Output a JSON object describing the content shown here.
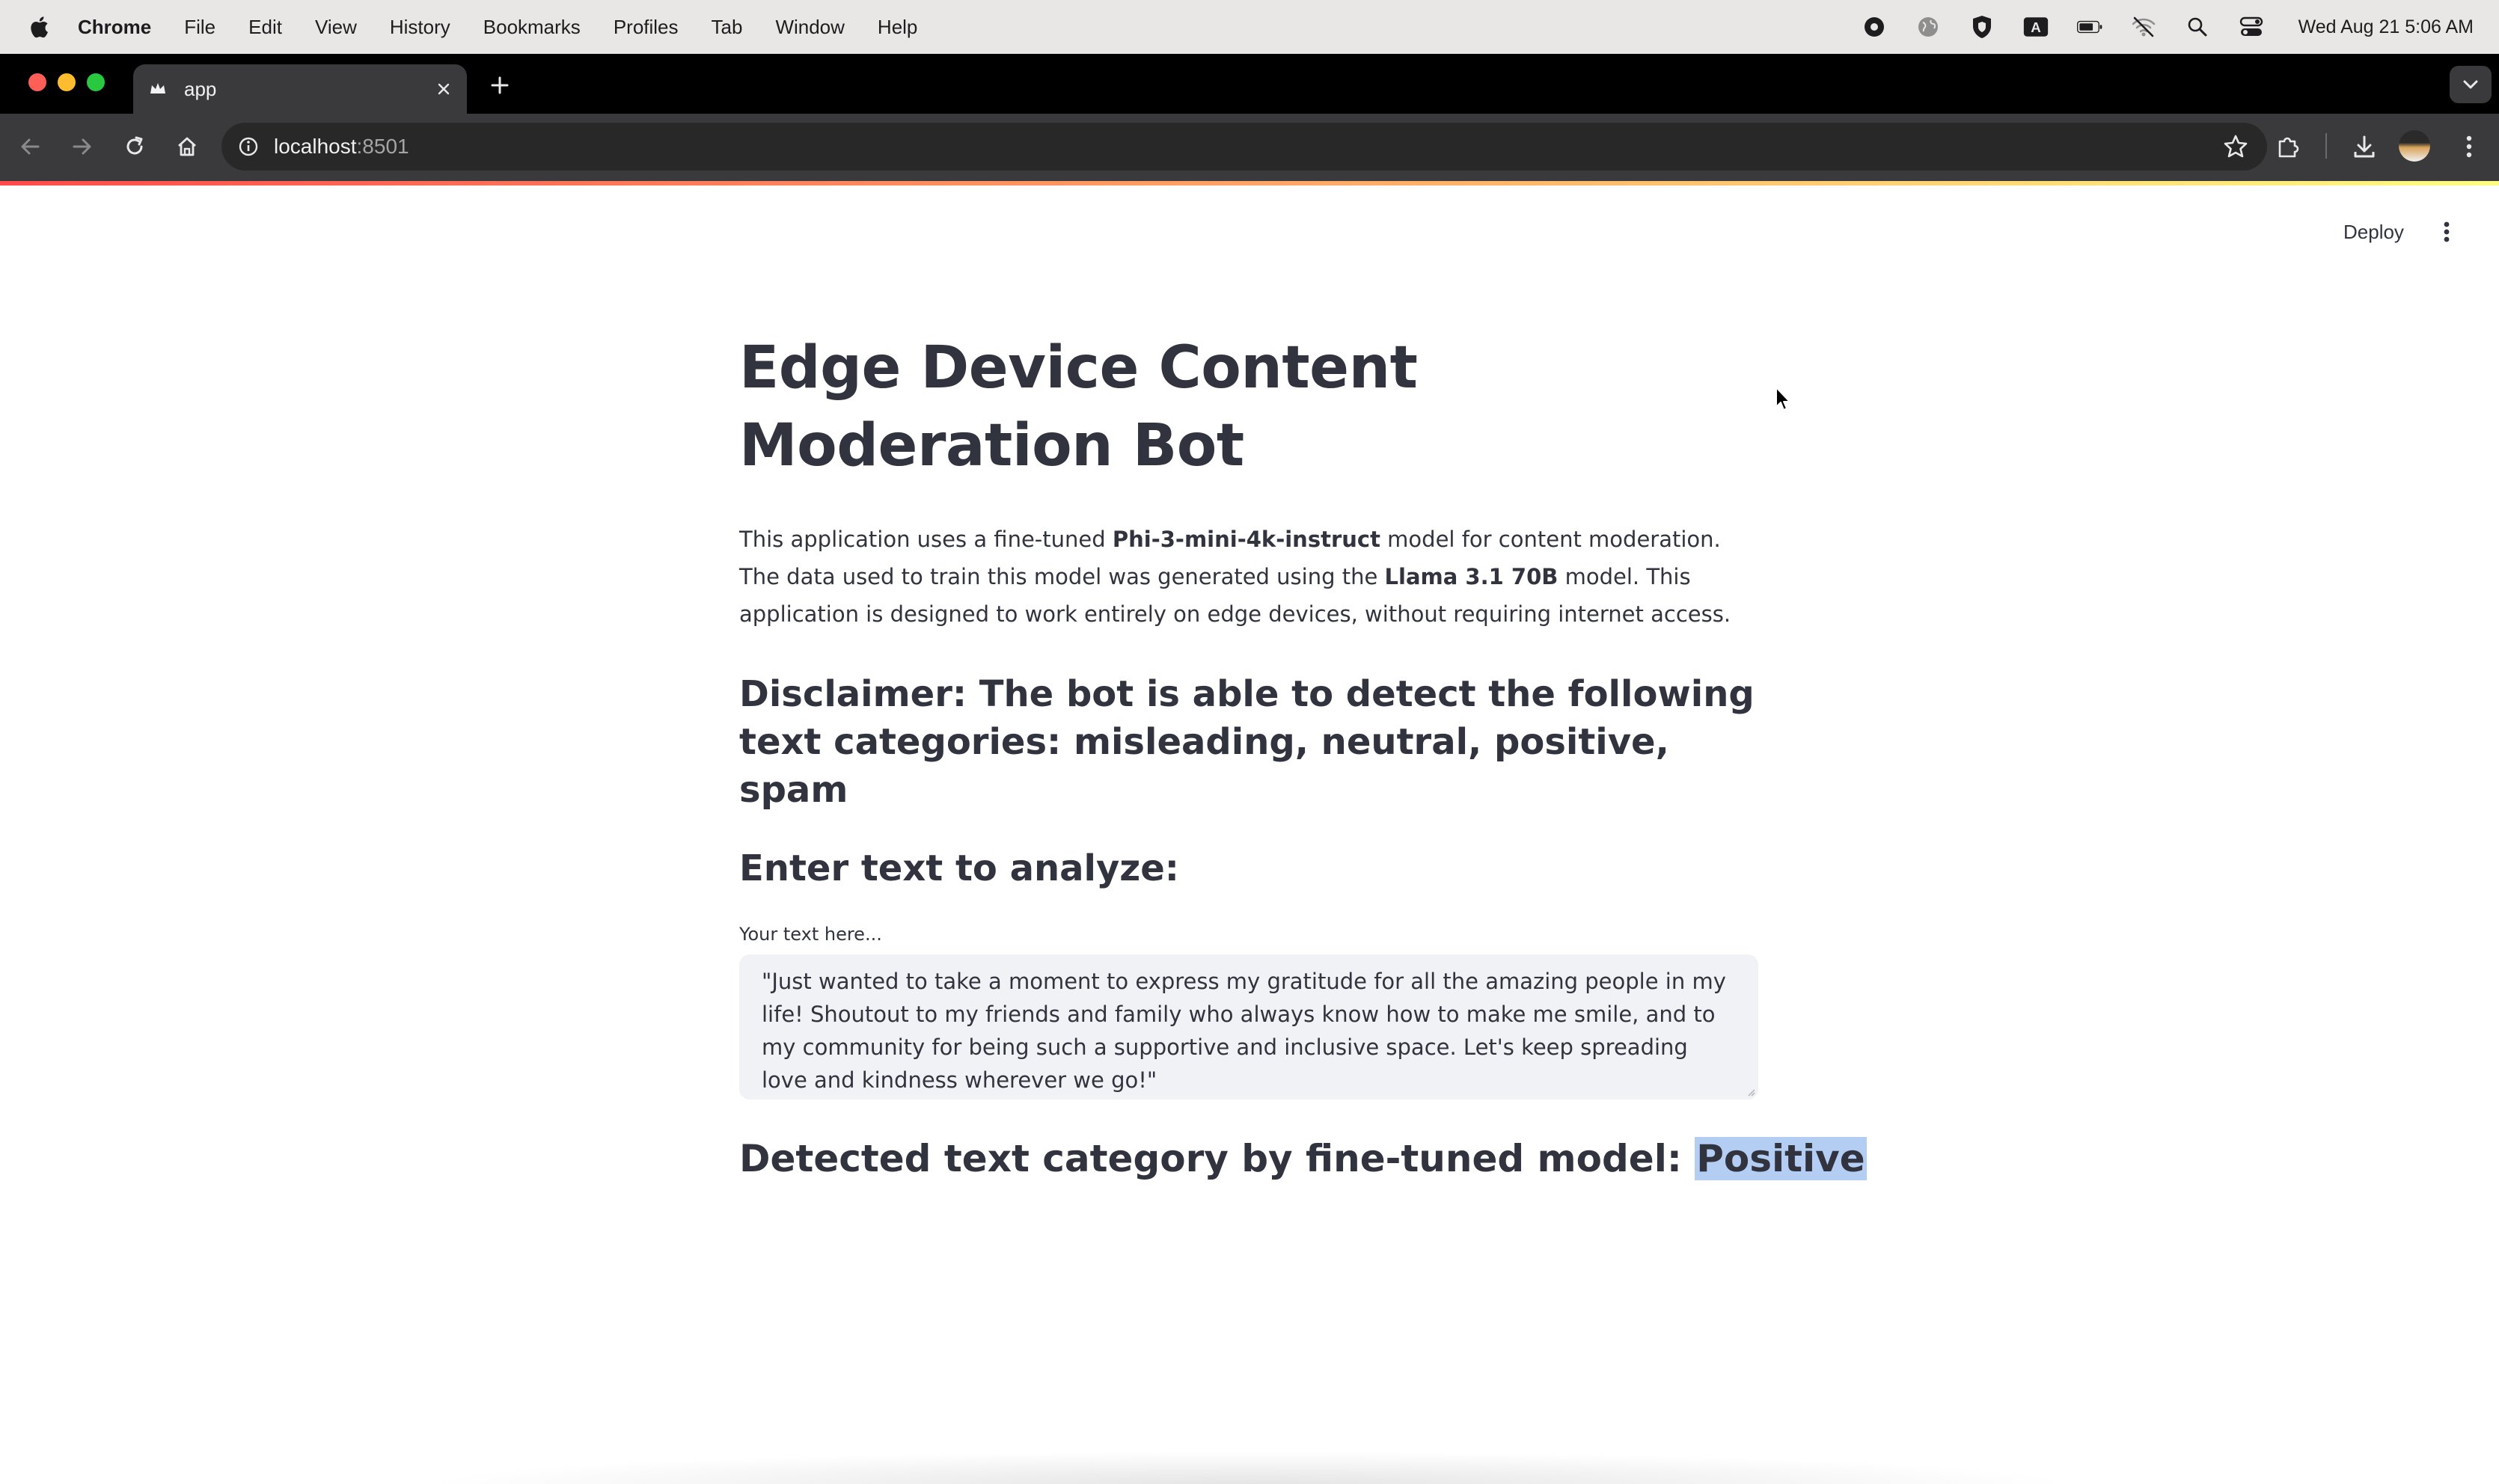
{
  "menubar": {
    "app": "Chrome",
    "items": [
      "File",
      "Edit",
      "View",
      "History",
      "Bookmarks",
      "Profiles",
      "Tab",
      "Window",
      "Help"
    ],
    "clock": "Wed Aug 21  5:06 AM",
    "status_icons": [
      "record-icon",
      "globe-icon",
      "shield-icon",
      "keyboard-a-icon",
      "battery-icon",
      "wifi-off-icon",
      "spotlight-icon",
      "control-center-icon"
    ]
  },
  "browser": {
    "tab_title": "app",
    "url_host": "localhost",
    "url_port": ":8501"
  },
  "app": {
    "deploy_label": "Deploy",
    "title": "Edge Device Content Moderation Bot",
    "intro": {
      "part1": "This application uses a fine-tuned ",
      "model1": "Phi-3-mini-4k-instruct",
      "part2": " model for content moderation. The data used to train this model was generated using the ",
      "model2": "Llama 3.1 70B",
      "part3": " model. This application is designed to work entirely on edge devices, without requiring internet access."
    },
    "disclaimer": "Disclaimer: The bot is able to detect the following text categories: misleading, neutral, positive, spam",
    "enter_heading": "Enter text to analyze:",
    "input_label": "Your text here...",
    "input_value": "\"Just wanted to take a moment to express my gratitude for all the amazing people in my life! Shoutout to my friends and family who always know how to make me smile, and to my community for being such a supportive and inclusive space. Let's keep spreading love and kindness wherever we go!\"",
    "result_prefix": "Detected text category by fine-tuned model: ",
    "result_value": "Positive"
  },
  "colors": {
    "text": "#31333f",
    "input_bg": "#f0f2f6",
    "highlight": "#b4cdf3",
    "decoration_start": "#ff4b4b",
    "decoration_end": "#fffd80"
  }
}
